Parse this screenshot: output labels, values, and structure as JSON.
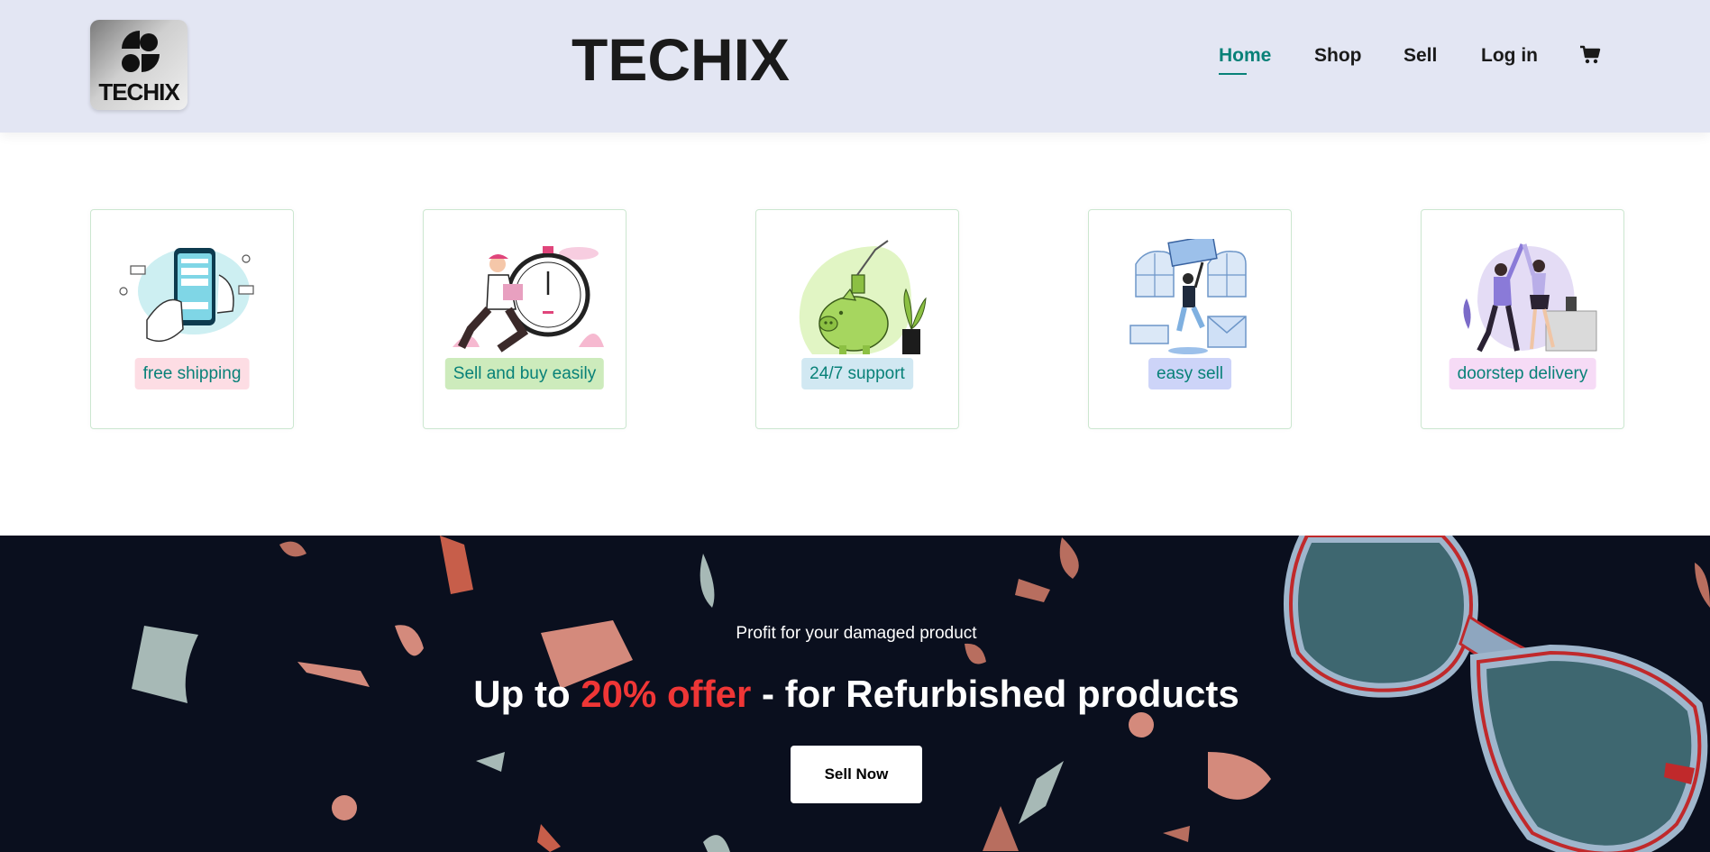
{
  "header": {
    "logo_text": "TECHIX",
    "brand": "TECHIX",
    "nav": [
      {
        "label": "Home",
        "active": true
      },
      {
        "label": "Shop",
        "active": false
      },
      {
        "label": "Sell",
        "active": false
      },
      {
        "label": "Log in",
        "active": false
      }
    ],
    "cart_icon": "cart-icon"
  },
  "features": [
    {
      "label": "free shipping",
      "icon": "phone-payment-illustration",
      "tag_color": "#fddde4"
    },
    {
      "label": "Sell and buy easily",
      "icon": "runner-stopwatch-illustration",
      "tag_color": "#cdebbc"
    },
    {
      "label": "24/7 support",
      "icon": "piggy-bank-illustration",
      "tag_color": "#d1e8f2"
    },
    {
      "label": "easy sell",
      "icon": "delivery-person-illustration",
      "tag_color": "#cdd4f8"
    },
    {
      "label": "doorstep delivery",
      "icon": "high-five-illustration",
      "tag_color": "#f6dbf6"
    }
  ],
  "banner": {
    "subtitle": "Profit for your damaged product",
    "title_prefix": "Up to ",
    "title_highlight": "20% offer",
    "title_suffix": " - for Refurbished products",
    "button_label": "Sell Now"
  },
  "colors": {
    "accent": "#088178",
    "header_bg": "#e3e6f3",
    "banner_bg": "#0a0f1e",
    "highlight": "#ef3636"
  }
}
